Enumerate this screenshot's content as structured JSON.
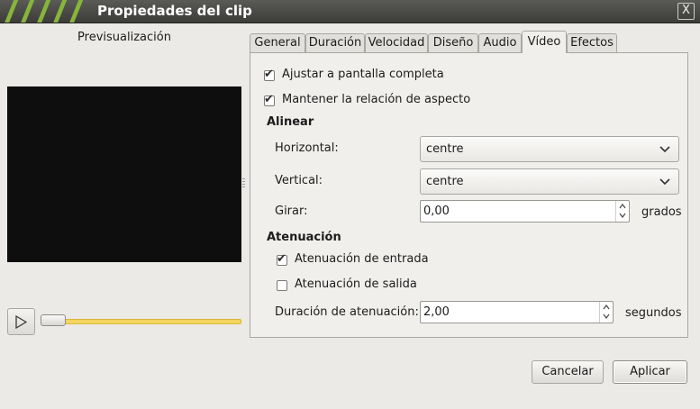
{
  "window": {
    "title": "Propiedades del clip",
    "close_glyph": "X"
  },
  "preview": {
    "title": "Previsualización",
    "play_icon": "play-icon"
  },
  "tabs": [
    {
      "label": "General"
    },
    {
      "label": "Duración"
    },
    {
      "label": "Velocidad"
    },
    {
      "label": "Diseño"
    },
    {
      "label": "Audio"
    },
    {
      "label": "Vídeo"
    },
    {
      "label": "Efectos"
    }
  ],
  "video": {
    "fit_screen_label": "Ajustar a pantalla completa",
    "fit_screen_checked": true,
    "keep_aspect_label": "Mantener la relación de aspecto",
    "keep_aspect_checked": true,
    "align_heading": "Alinear",
    "horizontal_label": "Horizontal:",
    "horizontal_value": "centre",
    "vertical_label": "Vertical:",
    "vertical_value": "centre",
    "rotate_label": "Girar:",
    "rotate_value": "0,00",
    "rotate_unit": "grados",
    "fade_heading": "Atenuación",
    "fade_in_label": "Atenuación de entrada",
    "fade_in_checked": true,
    "fade_out_label": "Atenuación de salida",
    "fade_out_checked": false,
    "fade_duration_label": "Duración de atenuación:",
    "fade_duration_value": "2,00",
    "fade_duration_unit": "segundos"
  },
  "buttons": {
    "cancel": "Cancelar",
    "apply": "Aplicar"
  },
  "colors": {
    "accent_green": "#87b43a",
    "slider_yellow": "#f3d45e",
    "titlebar": "#4a4a47"
  }
}
